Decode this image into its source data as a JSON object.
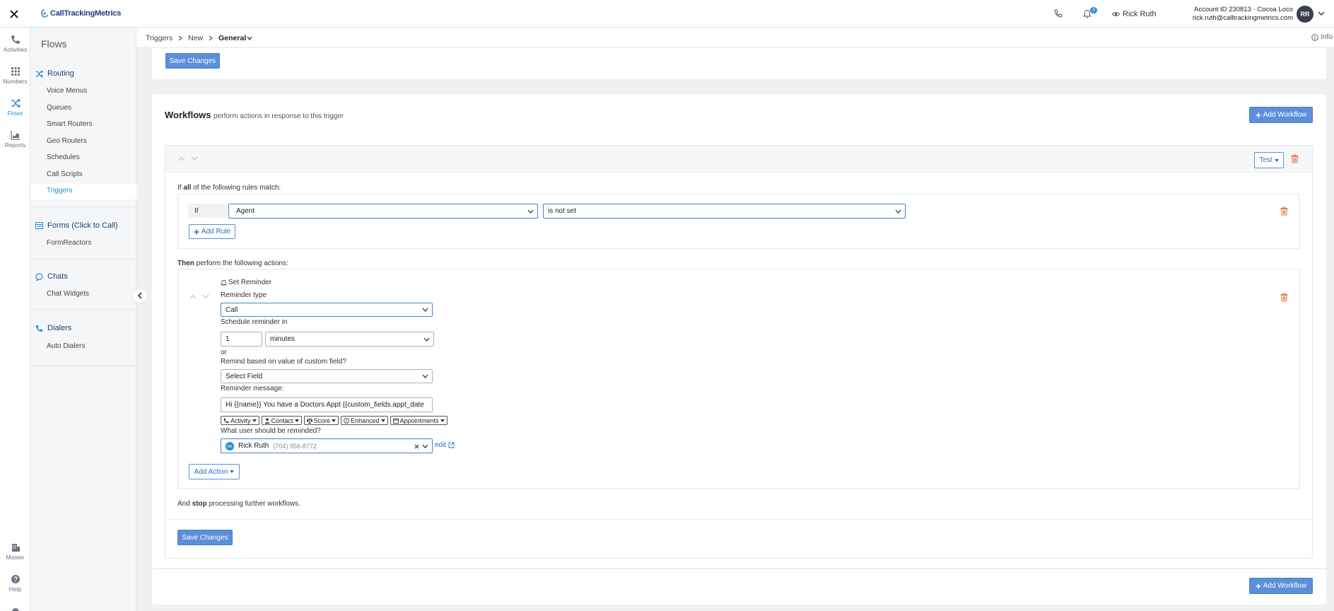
{
  "topbar": {
    "logo_text": "CallTrackingMetrics",
    "notification_count": "3",
    "user_name": "Rick Ruth",
    "account_line": "Account ID 230813  ·  Cocoa Loco",
    "account_email": "rick.ruth@calltrackingmetrics.com",
    "avatar_initials": "RR"
  },
  "rail": {
    "items": [
      {
        "label": "Activities",
        "icon": "phone-icon"
      },
      {
        "label": "Numbers",
        "icon": "grid-icon"
      },
      {
        "label": "Flows",
        "icon": "shuffle-icon"
      },
      {
        "label": "Reports",
        "icon": "chart-icon"
      },
      {
        "label": "Master",
        "icon": "building-icon"
      },
      {
        "label": "Help",
        "icon": "help-icon"
      }
    ]
  },
  "sidebar": {
    "title": "Flows",
    "sections": [
      {
        "heading": "Routing",
        "items": [
          "Voice Menus",
          "Queues",
          "Smart Routers",
          "Geo Routers",
          "Schedules",
          "Call Scripts",
          "Triggers"
        ]
      },
      {
        "heading": "Forms (Click to Call)",
        "items": [
          "FormReactors"
        ]
      },
      {
        "heading": "Chats",
        "items": [
          "Chat Widgets"
        ]
      },
      {
        "heading": "Dialers",
        "items": [
          "Auto Dialers"
        ]
      }
    ]
  },
  "breadcrumb": {
    "items": [
      "Triggers",
      "New",
      "General"
    ],
    "info_label": "Info"
  },
  "top_save_label": "Save Changes",
  "workflows": {
    "title": "Workflows",
    "subtitle": "perform actions in response to this trigger",
    "add_workflow_label": "Add Workflow",
    "test_label": "Test",
    "rules_intro_pre": "If ",
    "rules_intro_bold": "all",
    "rules_intro_post": " of the following rules match:",
    "rule": {
      "if_label": "If",
      "field": "Agent",
      "operator": "is not set"
    },
    "add_rule_label": "Add Rule",
    "actions_intro_bold": "Then",
    "actions_intro_post": " perform the following actions:",
    "action": {
      "title": "Set Reminder",
      "reminder_type_label": "Reminder type",
      "reminder_type_value": "Call",
      "schedule_label": "Schedule reminder in",
      "schedule_amount": "1",
      "schedule_unit": "minutes",
      "or_label": "or",
      "custom_field_label": "Remind based on value of custom field?",
      "custom_field_value": "Select Field",
      "message_label": "Reminder message:",
      "message_value": "Hi {{name}} You have a Doctors Appt {{custom_fields.appt_date",
      "tokens": [
        "Activity",
        "Contact",
        "Score",
        "Enhanced",
        "Appointments"
      ],
      "user_label": "What user should be reminded?",
      "user_name": "Rick Ruth",
      "user_phone": "(704) 956-8772",
      "edit_label": "edit"
    },
    "add_action_label": "Add Action",
    "stop_pre": "And ",
    "stop_bold": "stop",
    "stop_post": " processing further workflows.",
    "save_label": "Save Changes"
  }
}
